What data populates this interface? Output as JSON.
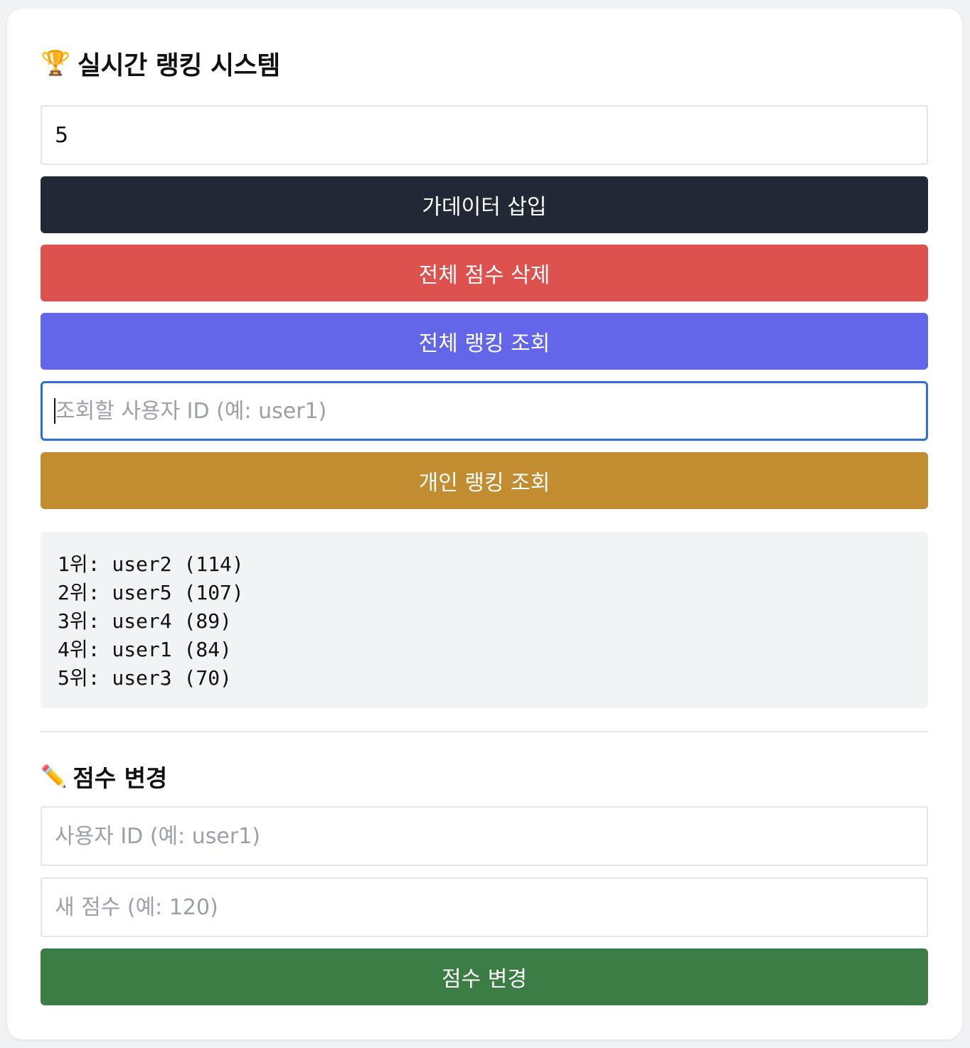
{
  "title": {
    "emoji": "🏆",
    "text": "실시간 랭킹 시스템"
  },
  "count_input": {
    "value": "5"
  },
  "buttons": {
    "insert_dummy": "가데이터 삽입",
    "delete_all": "전체 점수 삭제",
    "view_all": "전체 랭킹 조회",
    "view_user": "개인 랭킹 조회",
    "change_score": "점수 변경"
  },
  "lookup_input": {
    "placeholder": "조회할 사용자 ID (예: user1)",
    "value": ""
  },
  "ranking_lines": [
    "1위: user2 (114)",
    "2위: user5 (107)",
    "3위: user4 (89)",
    "4위: user1 (84)",
    "5위: user3 (70)"
  ],
  "update_section": {
    "emoji": "✏️",
    "title": "점수 변경",
    "user_placeholder": "사용자 ID (예: user1)",
    "score_placeholder": "새 점수 (예: 120)"
  },
  "colors": {
    "dark": "#212836",
    "red": "#dd524e",
    "blue": "#6366e8",
    "gold": "#c28c31",
    "green": "#3b7d44",
    "focus": "#2f6fd1"
  }
}
